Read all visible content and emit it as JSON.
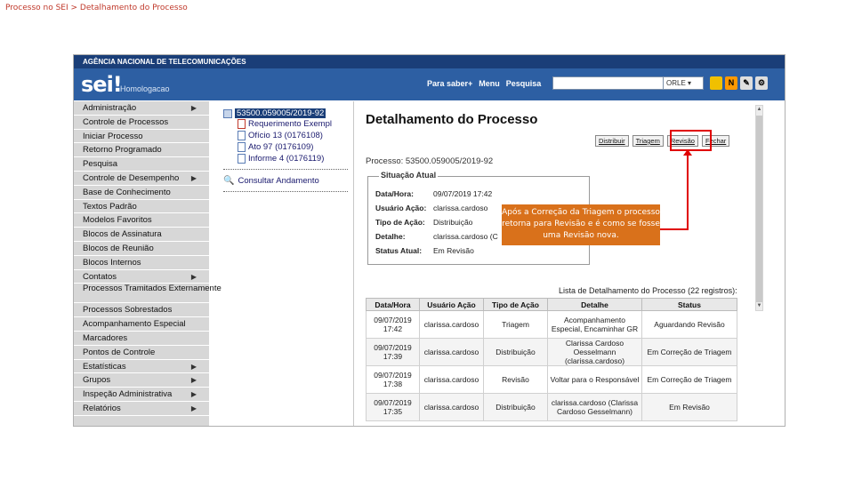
{
  "slide": {
    "caption": "Processo no SEI > Detalhamento do Processo"
  },
  "header": {
    "agency": "AGÊNCIA NACIONAL DE TELECOMUNICAÇÕES",
    "logo": "sei!",
    "env": "Homologacao",
    "nav": [
      "Para saber+",
      "Menu",
      "Pesquisa"
    ],
    "unit": "ORLE"
  },
  "sidebar": {
    "items": [
      {
        "label": "Administração",
        "arrow": true
      },
      {
        "label": "Controle de Processos",
        "arrow": false
      },
      {
        "label": "Iniciar Processo",
        "arrow": false
      },
      {
        "label": "Retorno Programado",
        "arrow": false
      },
      {
        "label": "Pesquisa",
        "arrow": false
      },
      {
        "label": "Controle de Desempenho",
        "arrow": true
      },
      {
        "label": "Base de Conhecimento",
        "arrow": false
      },
      {
        "label": "Textos Padrão",
        "arrow": false
      },
      {
        "label": "Modelos Favoritos",
        "arrow": false
      },
      {
        "label": "Blocos de Assinatura",
        "arrow": false
      },
      {
        "label": "Blocos de Reunião",
        "arrow": false
      },
      {
        "label": "Blocos Internos",
        "arrow": false
      },
      {
        "label": "Contatos",
        "arrow": true
      },
      {
        "label": "Processos Tramitados Externamente",
        "arrow": false,
        "tall": true
      },
      {
        "label": "Processos Sobrestados",
        "arrow": false
      },
      {
        "label": "Acompanhamento Especial",
        "arrow": false
      },
      {
        "label": "Marcadores",
        "arrow": false
      },
      {
        "label": "Pontos de Controle",
        "arrow": false
      },
      {
        "label": "Estatísticas",
        "arrow": true
      },
      {
        "label": "Grupos",
        "arrow": true
      },
      {
        "label": "Inspeção Administrativa",
        "arrow": true
      },
      {
        "label": "Relatórios",
        "arrow": true
      }
    ]
  },
  "tree": {
    "root": "53500.059005/2019-92",
    "items": [
      {
        "label": "Requerimento Exempl",
        "type": "pdf"
      },
      {
        "label": "Ofício 13 (0176108)",
        "type": "doc"
      },
      {
        "label": "Ato 97 (0176109)",
        "type": "doc"
      },
      {
        "label": "Informe 4 (0176119)",
        "type": "doc"
      }
    ],
    "link": "Consultar Andamento"
  },
  "main": {
    "title": "Detalhamento do Processo",
    "buttons": [
      "Distribuir",
      "Triagem",
      "Revisão",
      "Fechar"
    ],
    "process_label": "Processo: 53500.059005/2019-92",
    "situation": {
      "legend": "Situação Atual",
      "rows": [
        {
          "label": "Data/Hora:",
          "value": "09/07/2019 17:42"
        },
        {
          "label": "Usuário Ação:",
          "value": "clarissa.cardoso"
        },
        {
          "label": "Tipo de Ação:",
          "value": "Distribuição"
        },
        {
          "label": "Detalhe:",
          "value": "clarissa.cardoso (C"
        },
        {
          "label": "Status Atual:",
          "value": "Em Revisão"
        }
      ]
    },
    "callout": "Após a Correção da Triagem o processo retorna para Revisão e é como se fosse uma Revisão nova.",
    "table_caption": "Lista de Detalhamento do Processo (22 registros):",
    "table": {
      "headers": [
        "Data/Hora",
        "Usuário Ação",
        "Tipo de Ação",
        "Detalhe",
        "Status"
      ],
      "rows": [
        [
          "09/07/2019 17:42",
          "clarissa.cardoso",
          "Triagem",
          "Acompanhamento Especial, Encaminhar GR",
          "Aguardando Revisão"
        ],
        [
          "09/07/2019 17:39",
          "clarissa.cardoso",
          "Distribuição",
          "Clarissa Cardoso Oesselmann (clarissa.cardoso)",
          "Em Correção de Triagem"
        ],
        [
          "09/07/2019 17:38",
          "clarissa.cardoso",
          "Revisão",
          "Voltar para o Responsável",
          "Em Correção de Triagem"
        ],
        [
          "09/07/2019 17:35",
          "clarissa.cardoso",
          "Distribuição",
          "clarissa.cardoso (Clarissa Cardoso Gesselmann)",
          "Em Revisão"
        ]
      ]
    }
  },
  "icons": {
    "letters": [
      "N",
      "✎",
      "⚙"
    ],
    "colors": [
      "#f0c000",
      "#ff9900",
      "#cccccc",
      "#cccccc"
    ]
  }
}
